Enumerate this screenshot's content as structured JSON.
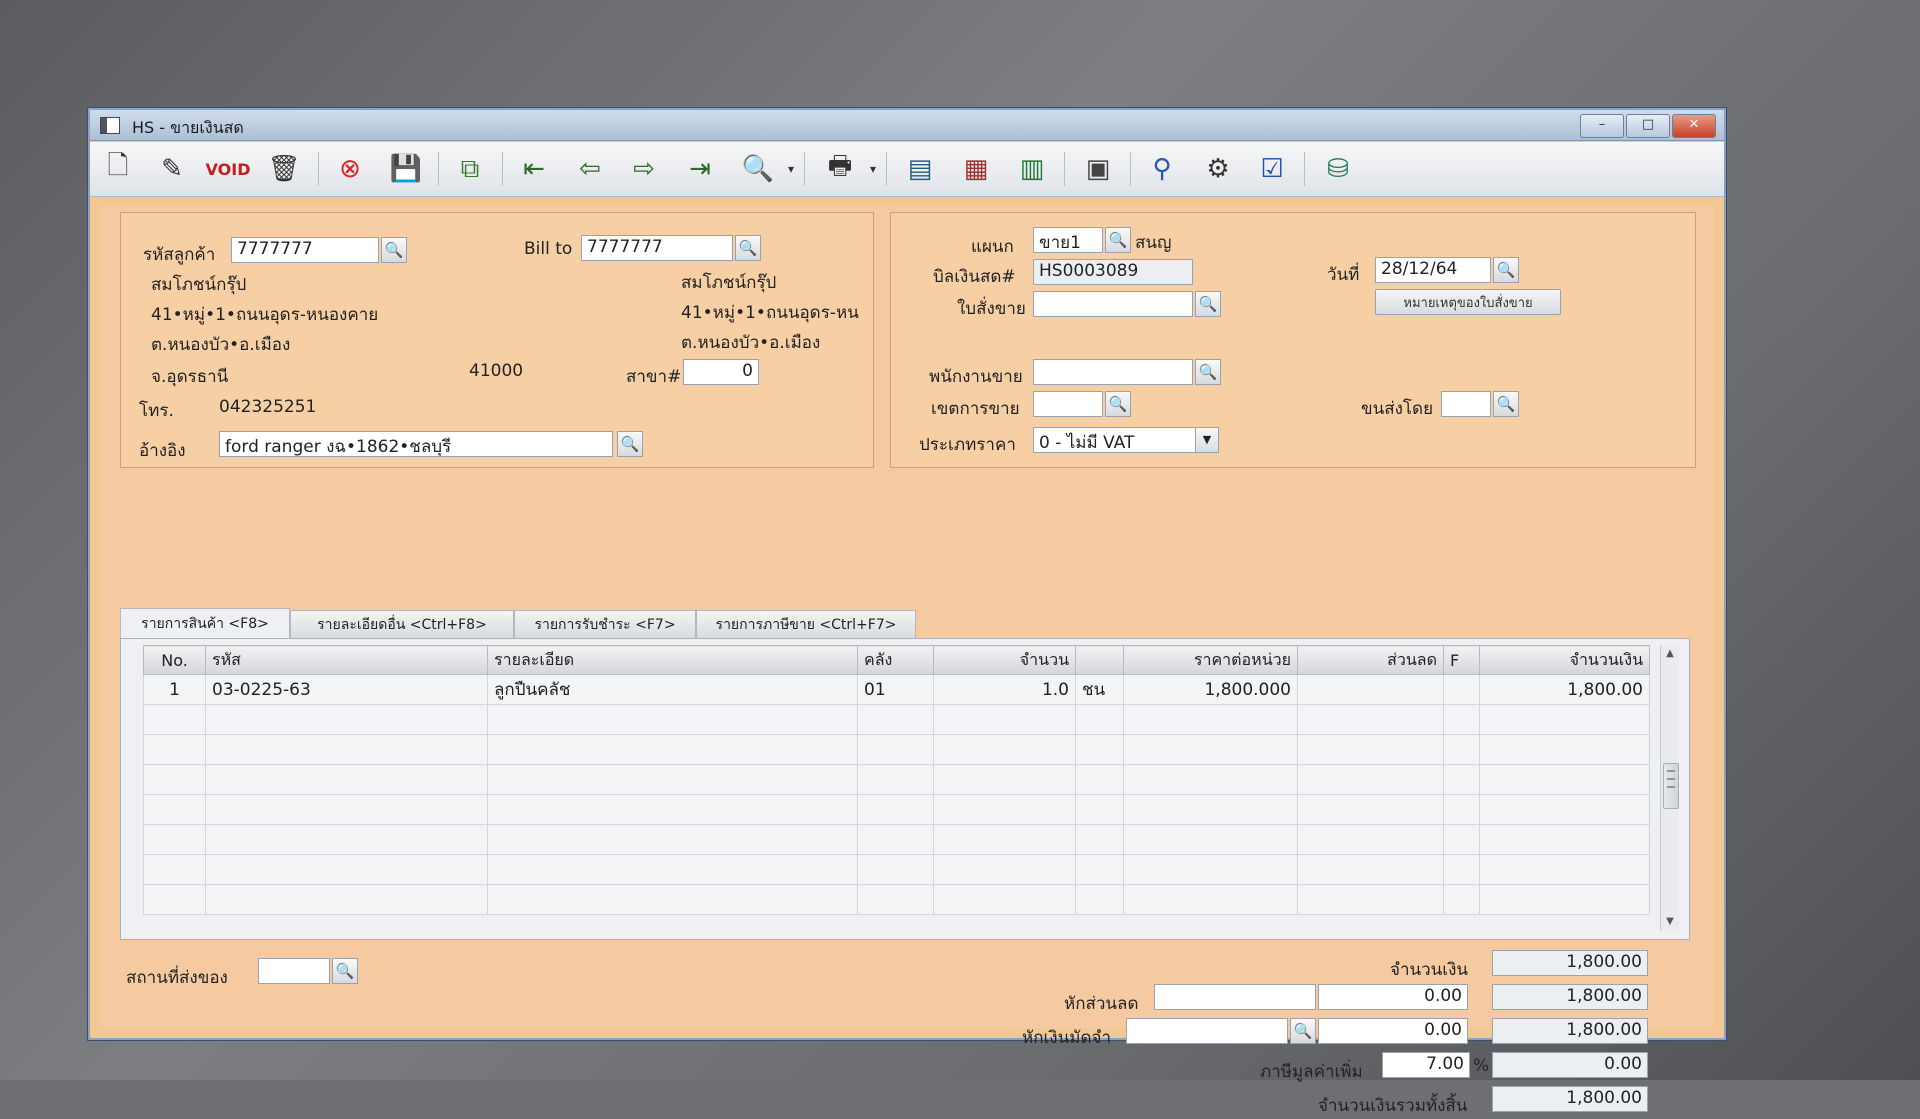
{
  "window": {
    "title": "HS - ขายเงินสด",
    "min": "–",
    "max": "□",
    "close": "✕"
  },
  "toolbar": {
    "icons": [
      "new-doc-icon",
      "edit-icon",
      "void-icon",
      "delete-icon",
      "cancel-icon",
      "save-icon",
      "copy-icon",
      "first-record-icon",
      "prev-record-icon",
      "next-record-icon",
      "last-record-icon",
      "search-doc-icon",
      "print-icon",
      "sr-icon",
      "discount-icon",
      "so-icon",
      "return-icon",
      "approve-icon",
      "credit-icon",
      "ok-icon",
      "export-icon"
    ]
  },
  "customer": {
    "code_label": "รหัสลูกค้า",
    "code_value": "7777777",
    "billto_label": "Bill to",
    "billto_value": "7777777",
    "name": "สมโภชน์กรุ๊ป",
    "addr1": "41•หมู่•1•ถนนอุดร-หนองคาย",
    "addr2": "ต.หนองบัว•อ.เมือง",
    "addr3": "จ.อุดรธานี",
    "postcode": "41000",
    "billto_name": "สมโภชน์กรุ๊ป",
    "billto_addr1": "41•หมู่•1•ถนนอุดร-หน",
    "billto_addr2": "ต.หนองบัว•อ.เมือง",
    "branch_label": "สาขา#",
    "branch_value": "0",
    "tel_label": "โทร.",
    "tel_value": "042325251",
    "ref_label": "อ้างอิง",
    "ref_value": "ford ranger งฉ•1862•ชลบุรี"
  },
  "doc": {
    "dept_label": "แผนก",
    "dept_value": "ขาย1",
    "dept_name": "สนญ",
    "bill_label": "บิลเงินสด#",
    "bill_value": "HS0003089",
    "date_label": "วันที่",
    "date_value": "28/12/64",
    "order_label": "ใบสั่งขาย",
    "order_value": "",
    "note_button": "หมายเหตุของใบสั่งขาย",
    "sales_label": "พนักงานขาย",
    "sales_value": "",
    "area_label": "เขตการขาย",
    "area_value": "",
    "ship_label": "ขนส่งโดย",
    "ship_value": "",
    "price_type_label": "ประเภทราคา",
    "price_type_value": "0 - ไม่มี VAT"
  },
  "tabs": [
    "รายการสินค้า <F8>",
    "รายละเอียดอื่น <Ctrl+F8>",
    "รายการรับชำระ <F7>",
    "รายการภาษีขาย <Ctrl+F7>"
  ],
  "grid": {
    "headers": [
      "No.",
      "รหัส",
      "รายละเอียด",
      "คลัง",
      "จำนวน",
      "",
      "ราคาต่อหน่วย",
      "ส่วนลด",
      "F",
      "จำนวนเงิน"
    ],
    "rows": [
      [
        "1",
        "03-0225-63",
        "ลูกปืนคลัช",
        "01",
        "1.0",
        "ชน",
        "1,800.000",
        "",
        "",
        "1,800.00"
      ]
    ]
  },
  "footer": {
    "deliver_label": "สถานที่ส่งของ",
    "deliver_value": "",
    "amount_label": "จำนวนเงิน",
    "amount_value": "1,800.00",
    "discount_label": "หักส่วนลด",
    "discount_text": "",
    "discount_amt": "0.00",
    "after_discount": "1,800.00",
    "deposit_label": "หักเงินมัดจำ",
    "deposit_text": "",
    "deposit_amt": "0.00",
    "after_deposit": "1,800.00",
    "vat_label": "ภาษีมูลค่าเพิ่ม",
    "vat_rate": "7.00",
    "vat_pct": "%",
    "vat_amount": "0.00",
    "total_label": "จำนวนเงินรวมทั้งสิ้น",
    "total_value": "1,800.00"
  }
}
